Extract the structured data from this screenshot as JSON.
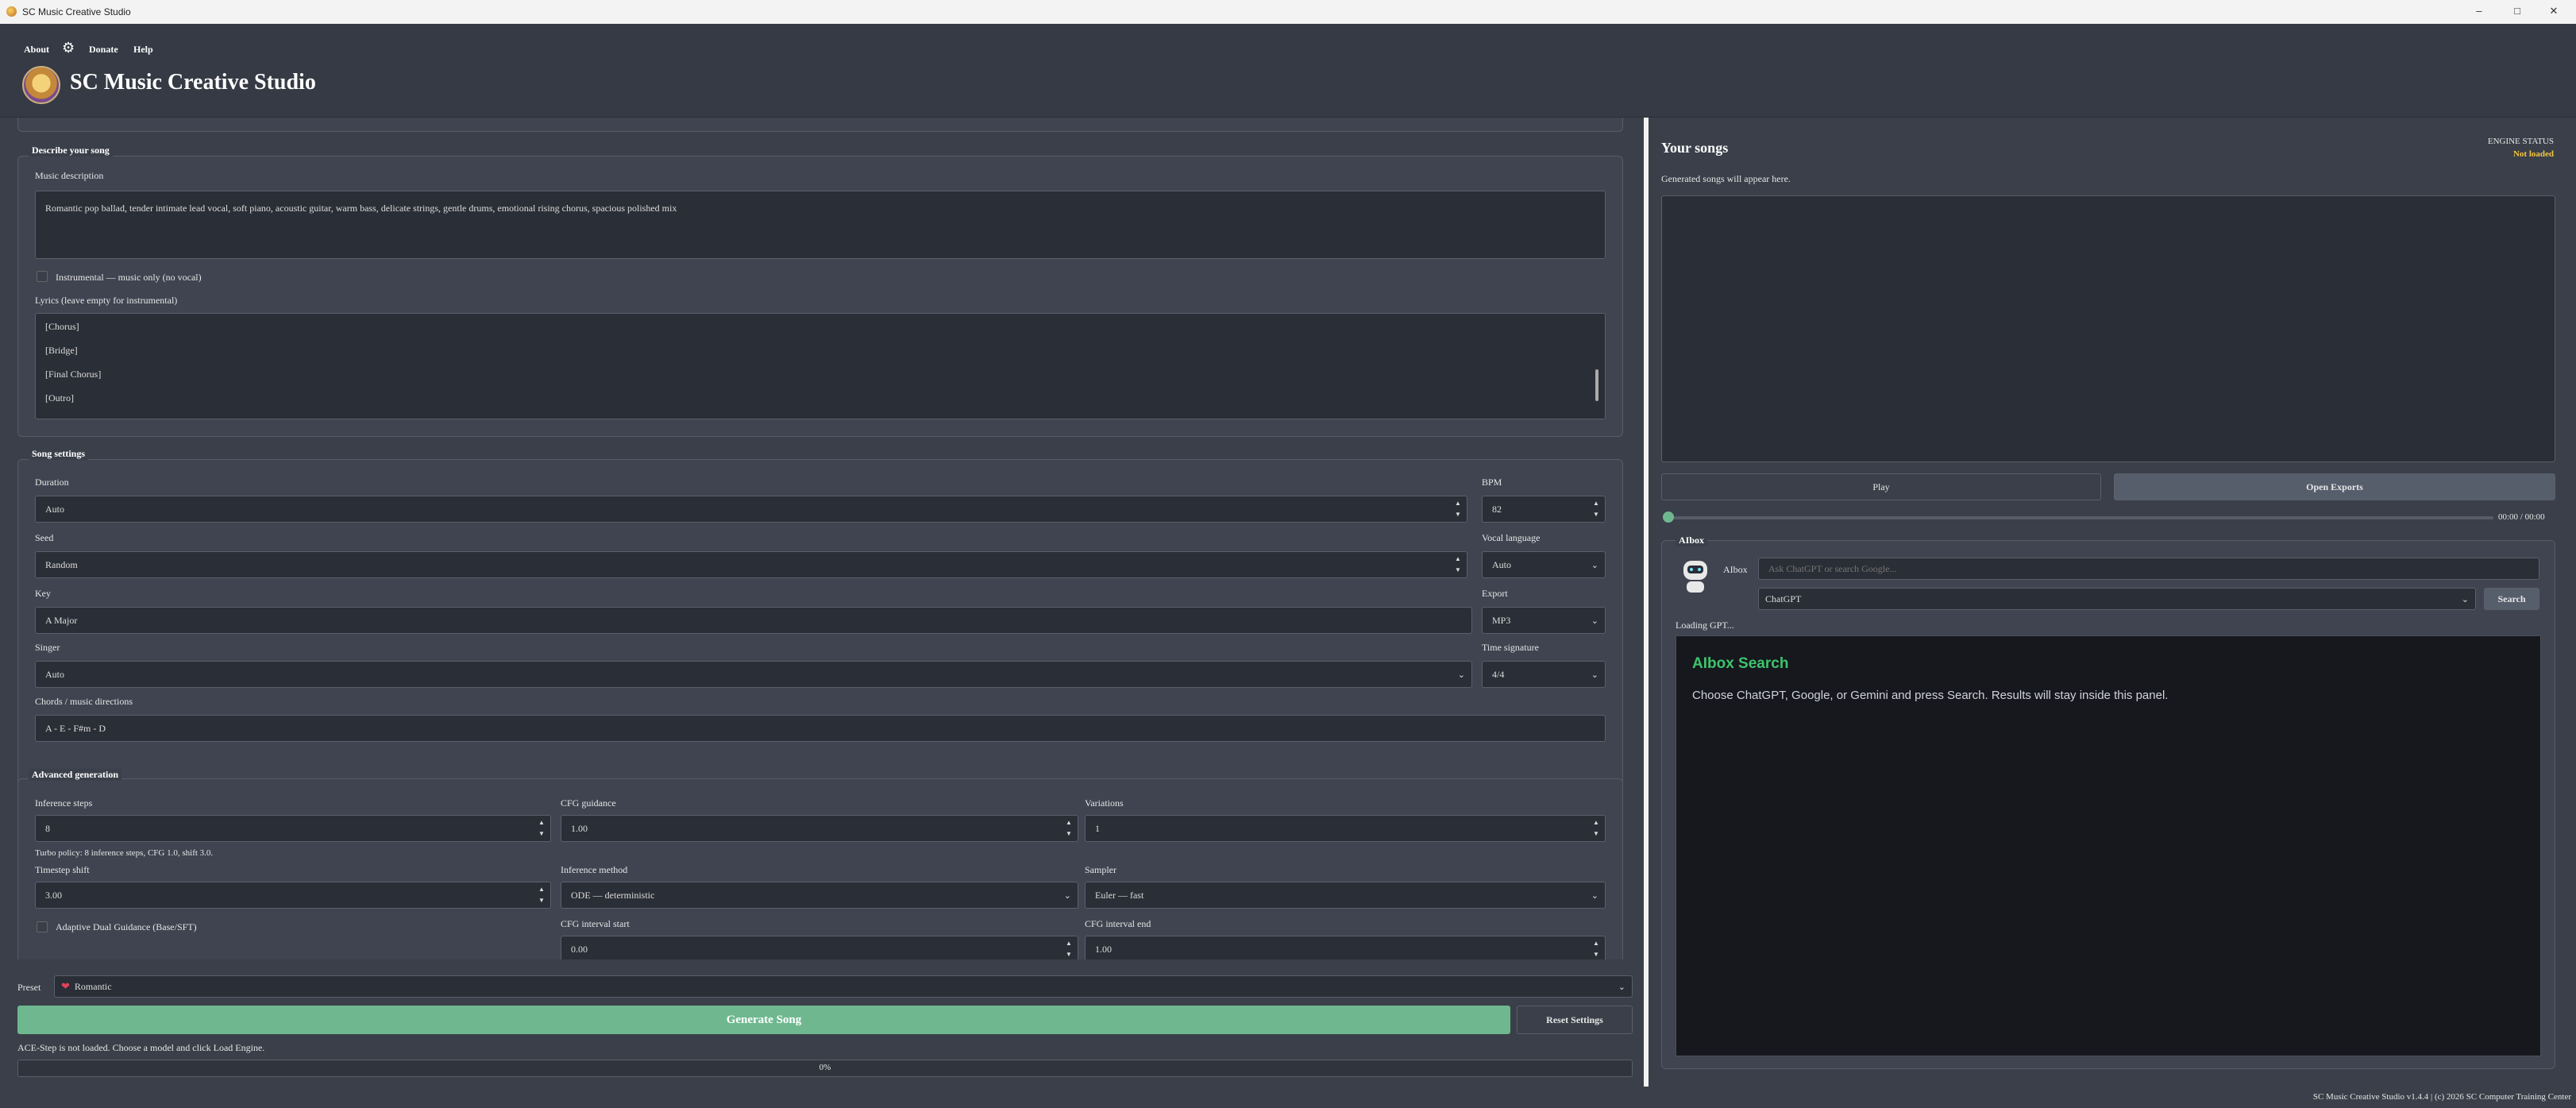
{
  "window": {
    "title": "SC Music Creative Studio"
  },
  "header": {
    "menu": {
      "about": "About",
      "donate": "Donate",
      "help": "Help"
    },
    "app_title": "SC Music Creative Studio"
  },
  "describe": {
    "group_title": "Describe your song",
    "music_description_label": "Music description",
    "music_description_value": "Romantic pop ballad, tender intimate lead vocal, soft piano, acoustic guitar, warm bass, delicate strings, gentle drums, emotional rising chorus, spacious polished mix",
    "instrumental_label": "Instrumental — music only (no vocal)",
    "lyrics_label": "Lyrics (leave empty for instrumental)",
    "lyrics_lines": [
      "[Chorus]",
      "[Bridge]",
      "[Final Chorus]",
      "[Outro]"
    ]
  },
  "song_settings": {
    "group_title": "Song settings",
    "duration_label": "Duration",
    "duration_value": "Auto",
    "bpm_label": "BPM",
    "bpm_value": "82",
    "seed_label": "Seed",
    "seed_value": "Random",
    "vocal_language_label": "Vocal language",
    "vocal_language_value": "Auto",
    "key_label": "Key",
    "key_value": "A Major",
    "export_label": "Export",
    "export_value": "MP3",
    "singer_label": "Singer",
    "singer_value": "Auto",
    "time_signature_label": "Time signature",
    "time_signature_value": "4/4",
    "chords_label": "Chords / music directions",
    "chords_value": "A - E - F#m - D"
  },
  "advanced": {
    "group_title": "Advanced generation",
    "inference_steps_label": "Inference steps",
    "inference_steps_value": "8",
    "cfg_guidance_label": "CFG guidance",
    "cfg_guidance_value": "1.00",
    "variations_label": "Variations",
    "variations_value": "1",
    "turbo_policy": "Turbo policy: 8 inference steps, CFG 1.0, shift 3.0.",
    "timestep_shift_label": "Timestep shift",
    "timestep_shift_value": "3.00",
    "inference_method_label": "Inference method",
    "inference_method_value": "ODE — deterministic",
    "sampler_label": "Sampler",
    "sampler_value": "Euler — fast",
    "adaptive_label": "Adaptive Dual Guidance (Base/SFT)",
    "cfg_start_label": "CFG interval start",
    "cfg_start_value": "0.00",
    "cfg_end_label": "CFG interval end",
    "cfg_end_value": "1.00"
  },
  "bottom": {
    "preset_label": "Preset",
    "preset_value": "Romantic",
    "generate_label": "Generate Song",
    "reset_label": "Reset Settings",
    "status_text": "ACE-Step is not loaded. Choose a model and click Load Engine.",
    "progress_text": "0%",
    "progress": 0
  },
  "songs": {
    "title": "Your songs",
    "subtitle": "Generated songs will appear here.",
    "engine_status_label": "ENGINE STATUS",
    "engine_status_value": "Not loaded",
    "play_label": "Play",
    "open_exports_label": "Open Exports",
    "time_text": "00:00 / 00:00"
  },
  "aibox": {
    "group_title": "AIbox",
    "name_label": "AIbox",
    "search_placeholder": "Ask ChatGPT or search Google...",
    "provider_value": "ChatGPT",
    "search_label": "Search",
    "loading_text": "Loading GPT...",
    "result_title": "AIbox Search",
    "result_text": "Choose ChatGPT, Google, or Gemini and press Search. Results will stay inside this panel."
  },
  "footer": {
    "text": "SC Music Creative Studio v1.4.4 | (c) 2026 SC Computer Training Center"
  },
  "colors": {
    "accent_green": "#6fb88f",
    "warning_yellow": "#f5c542",
    "result_title_green": "#3ec46d"
  }
}
